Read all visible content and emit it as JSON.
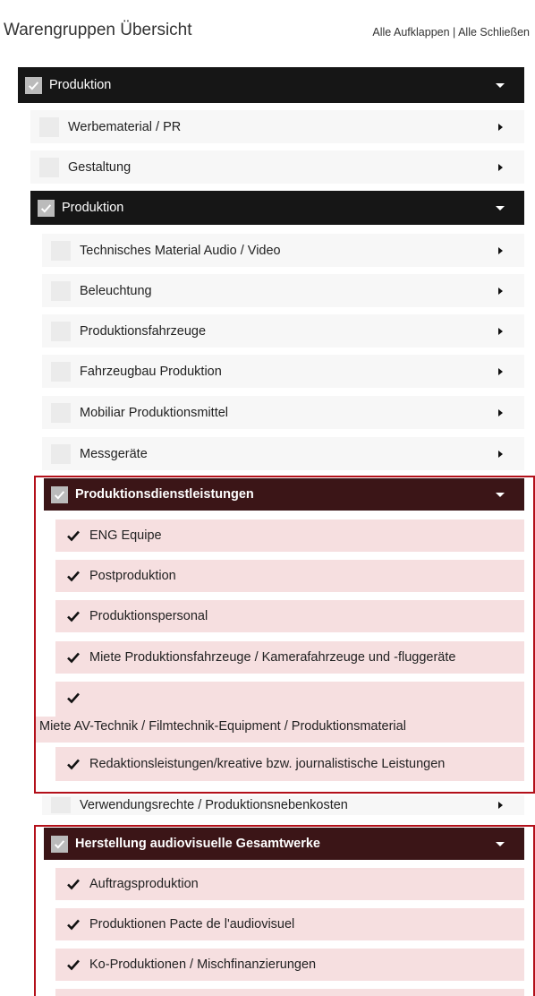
{
  "header": {
    "title": "Warengruppen Übersicht",
    "expand_all": "Alle Aufklappen",
    "separator": "|",
    "collapse_all": "Alle Schließen"
  },
  "tree": {
    "root": "Produktion",
    "level1": [
      "Werbematerial / PR",
      "Gestaltung"
    ],
    "sub_root": "Produktion",
    "level2": [
      "Technisches Material Audio / Video",
      "Beleuchtung",
      "Produktionsfahrzeuge",
      "Fahrzeugbau Produktion",
      "Mobiliar Produktionsmittel",
      "Messgeräte"
    ],
    "group_a": {
      "title": "Produktionsdienstleistungen",
      "items": [
        "ENG Equipe",
        "Postproduktion",
        "Produktionspersonal",
        "Miete Produktionsfahrzeuge / Kamerafahrzeuge und -fluggeräte",
        "Miete AV-Technik / Filmtechnik-Equipment / Produktionsmaterial",
        "Redaktionsleistungen/kreative bzw. journalistische Leistungen"
      ]
    },
    "after_group_a": "Verwendungsrechte / Produktionsnebenkosten",
    "group_b": {
      "title": "Herstellung audiovisuelle Gesamtwerke",
      "items": [
        "Auftragsproduktion",
        "Produktionen Pacte de l'audiovisuel",
        "Ko-Produktionen / Mischfinanzierungen"
      ]
    }
  },
  "colors": {
    "dark_header": "#161616",
    "selected_header": "#3b1517",
    "selected_item": "#f6dfe0",
    "highlight_border": "#b3101a"
  },
  "icons": {
    "checkbox": "checkmark-icon",
    "expand": "caret-right-icon",
    "collapse": "caret-down-icon"
  }
}
